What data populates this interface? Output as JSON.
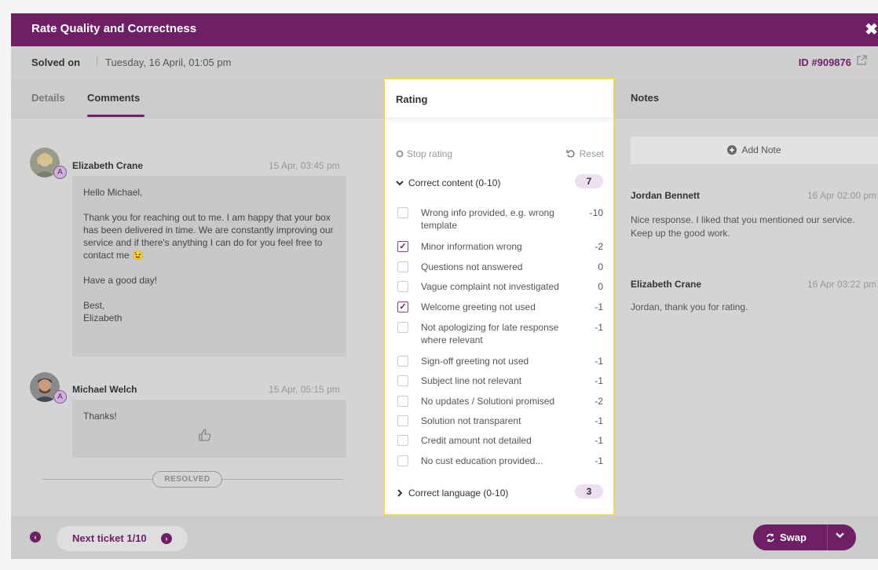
{
  "modal": {
    "title": "Rate Quality and Correctness",
    "close_glyph": "✖"
  },
  "ticket": {
    "solved_label": "Solved on",
    "separator": "|",
    "solved_date": "Tuesday, 16 April, 01:05 pm",
    "id_label": "ID #909876"
  },
  "tabs": {
    "details": "Details",
    "comments": "Comments",
    "active": "Comments"
  },
  "comments": [
    {
      "author": "Elizabeth Crane",
      "time": "15 Apr, 03:45 pm",
      "badge": "A",
      "paragraphs": [
        "Hello Michael,",
        "Thank you for reaching out to me. I am happy that your box has been delivered in time. We are constantly improving our service and if there's anything I can do for you feel free to contact me 😉",
        "Have a good day!",
        "Best,\nElizabeth"
      ]
    },
    {
      "author": "Michael Welch",
      "time": "15 Apr, 05:15 pm",
      "badge": "A",
      "paragraphs": [
        "Thanks!"
      ],
      "reaction_icon": "thumbs-up-icon"
    }
  ],
  "status_label": "RESOLVED",
  "rating": {
    "header": "Rating",
    "stop_label": "Stop rating",
    "reset_label": "Reset",
    "sections": [
      {
        "label": "Correct content (0-10)",
        "score": "7",
        "expanded": true,
        "items": [
          {
            "label": "Wrong info provided, e.g. wrong template",
            "value": "-10",
            "checked": false
          },
          {
            "label": "Minor information wrong",
            "value": "-2",
            "checked": true
          },
          {
            "label": "Questions not answered",
            "value": "0",
            "checked": false
          },
          {
            "label": "Vague complaint not investigated",
            "value": "0",
            "checked": false
          },
          {
            "label": "Welcome greeting not used",
            "value": "-1",
            "checked": true
          },
          {
            "label": "Not apologizing for late response where relevant",
            "value": "-1",
            "checked": false
          },
          {
            "label": "Sign-off greeting not used",
            "value": "-1",
            "checked": false
          },
          {
            "label": "Subject line not relevant",
            "value": "-1",
            "checked": false
          },
          {
            "label": "No updates / Solutioni promised",
            "value": "-2",
            "checked": false
          },
          {
            "label": "Solution not transparent",
            "value": "-1",
            "checked": false
          },
          {
            "label": "Credit amount not detailed",
            "value": "-1",
            "checked": false
          },
          {
            "label": "No cust education provided...",
            "value": "-1",
            "checked": false
          }
        ]
      },
      {
        "label": "Correct language (0-10)",
        "score": "3",
        "expanded": false
      }
    ]
  },
  "notes": {
    "header": "Notes",
    "add_label": "Add Note",
    "items": [
      {
        "author": "Jordan Bennett",
        "time": "16 Apr 02:00 pm",
        "text": "Nice response. I liked that you mentioned our service. Keep up the good work."
      },
      {
        "author": "Elizabeth Crane",
        "time": "16 Apr 03:22 pm",
        "text": "Jordan, thank you for rating."
      }
    ]
  },
  "footer": {
    "next_label": "Next ticket 1/10",
    "swap_label": "Swap"
  },
  "colors": {
    "brand": "#6e1f66",
    "highlight_border": "#f1d858",
    "badge_bg": "#ecdff0"
  }
}
